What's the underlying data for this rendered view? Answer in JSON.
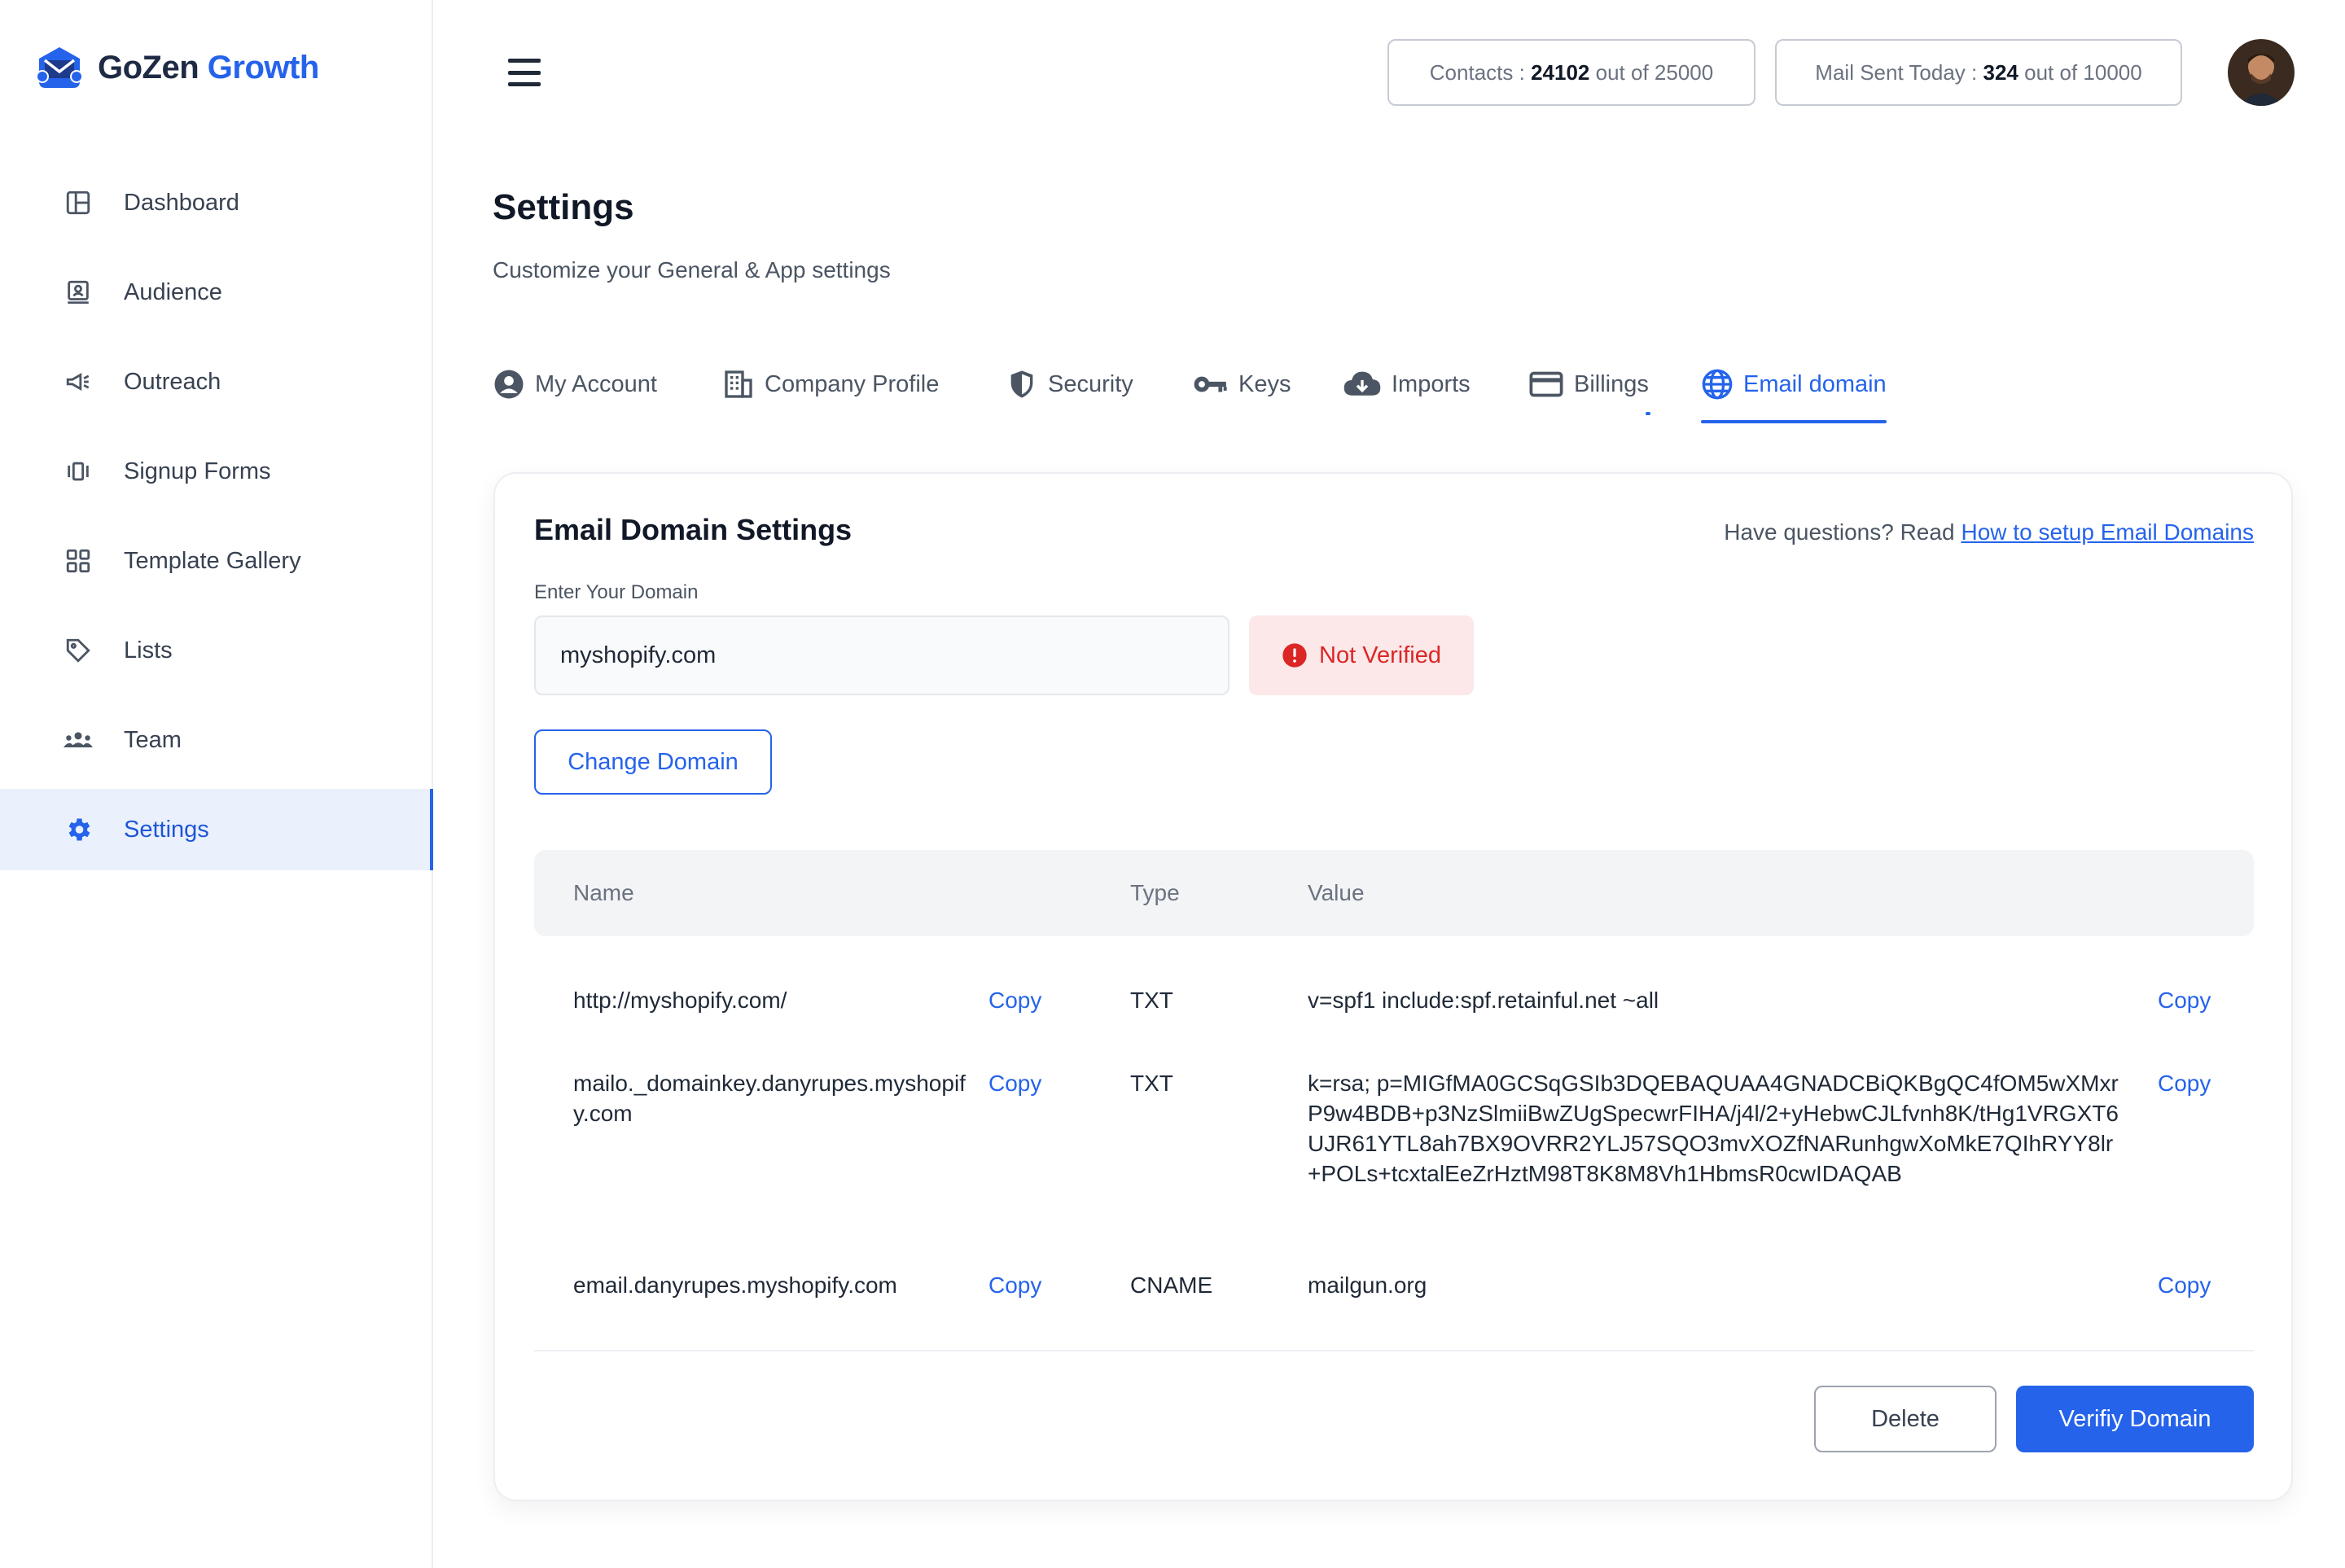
{
  "brand": {
    "name_part1": "GoZen",
    "name_part2": "Growth"
  },
  "sidebar": {
    "items": [
      {
        "label": "Dashboard",
        "icon": "dashboard-icon"
      },
      {
        "label": "Audience",
        "icon": "audience-icon"
      },
      {
        "label": "Outreach",
        "icon": "megaphone-icon"
      },
      {
        "label": "Signup Forms",
        "icon": "signup-forms-icon"
      },
      {
        "label": "Template Gallery",
        "icon": "grid-icon"
      },
      {
        "label": "Lists",
        "icon": "tag-icon"
      },
      {
        "label": "Team",
        "icon": "team-icon"
      },
      {
        "label": "Settings",
        "icon": "gear-icon",
        "active": true
      }
    ]
  },
  "header": {
    "contacts": {
      "label": "Contacts :",
      "value": "24102",
      "suffix": "out of 25000"
    },
    "mail": {
      "label": "Mail Sent Today :",
      "value": "324",
      "suffix": "out of 10000"
    }
  },
  "page": {
    "title": "Settings",
    "subtitle": "Customize your General & App settings"
  },
  "tabs": [
    {
      "label": "My Account",
      "icon": "user-circle-icon"
    },
    {
      "label": "Company Profile",
      "icon": "building-icon"
    },
    {
      "label": "Security",
      "icon": "shield-icon"
    },
    {
      "label": "Keys",
      "icon": "key-icon"
    },
    {
      "label": "Imports",
      "icon": "cloud-download-icon"
    },
    {
      "label": "Billings",
      "icon": "credit-card-icon"
    },
    {
      "label": "Email domain",
      "icon": "globe-icon",
      "active": true
    }
  ],
  "card": {
    "title": "Email Domain Settings",
    "help_text": "Have questions? Read",
    "help_link": "How to setup Email Domains",
    "field_label": "Enter Your Domain",
    "domain_value": "myshopify.com",
    "status": "Not Verified",
    "change_button": "Change Domain",
    "table": {
      "headers": [
        "Name",
        "Type",
        "Value"
      ],
      "copy_label": "Copy",
      "rows": [
        {
          "name": "http://myshopify.com/",
          "type": "TXT",
          "value": "v=spf1 include:spf.retainful.net ~all"
        },
        {
          "name": "mailo._domainkey.danyrupes.myshopify.com",
          "type": "TXT",
          "value": "k=rsa; p=MIGfMA0GCSqGSIb3DQEBAQUAA4GNADCBiQKBgQC4fOM5wXMxrP9w4BDB+p3NzSlmiiBwZUgSpecwrFIHA/j4l/2+yHebwCJLfvnh8K/tHg1VRGXT6UJR61YTL8ah7BX9OVRR2YLJ57SQO3mvXOZfNARunhgwXoMkE7QIhRYY8lr+POLs+tcxtalEeZrHztM98T8K8M8Vh1HbmsR0cwIDAQAB"
        },
        {
          "name": "email.danyrupes.myshopify.com",
          "type": "CNAME",
          "value": "mailgun.org"
        }
      ]
    },
    "delete_button": "Delete",
    "verify_button": "Verifiy Domain"
  },
  "colors": {
    "accent": "#2563eb",
    "danger": "#dc2626",
    "danger_bg": "#fce8e8"
  }
}
